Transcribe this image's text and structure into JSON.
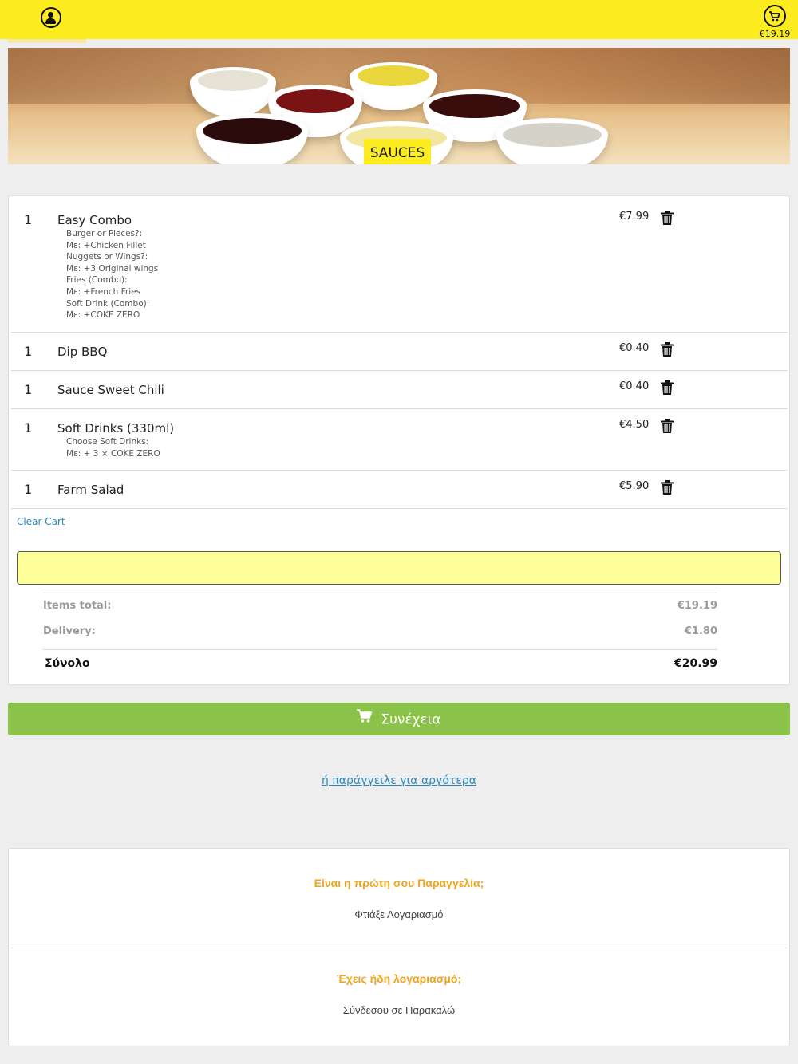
{
  "header": {
    "user_icon": "user-circle-icon",
    "cart_icon": "cart-circle-icon",
    "cart_total": "€19.19",
    "accent_color": "#fdec20"
  },
  "hero": {
    "label": "SAUCES"
  },
  "cart": {
    "items": [
      {
        "qty": "1",
        "name": "Easy Combo",
        "price": "€7.99",
        "options": [
          "Burger or Pieces?:",
          "Με: +Chicken Fillet",
          "Nuggets or Wings?:",
          "Με: +3 Original wings",
          "Fries (Combo):",
          "Με: +French Fries",
          "Soft Drink (Combo):",
          "Με: +COKE ZERO"
        ]
      },
      {
        "qty": "1",
        "name": "Dip BBQ",
        "price": "€0.40",
        "options": []
      },
      {
        "qty": "1",
        "name": "Sauce Sweet Chili",
        "price": "€0.40",
        "options": []
      },
      {
        "qty": "1",
        "name": "Soft Drinks (330ml)",
        "price": "€4.50",
        "options": [
          "Choose Soft Drinks:",
          "Με: + 3 × COKE ZERO"
        ]
      },
      {
        "qty": "1",
        "name": "Farm Salad",
        "price": "€5.90",
        "options": []
      }
    ],
    "clear_label": "Clear Cart",
    "coupon_value": "",
    "items_total_label": "Items total:",
    "items_total_value": "€19.19",
    "delivery_label": "Delivery:",
    "delivery_value": "€1.80",
    "grand_total_label": "Σύνολο",
    "grand_total_value": "€20.99"
  },
  "actions": {
    "continue_label": "Συνέχεια",
    "continue_color": "#8bc34a",
    "order_later_label": "ή παράγγειλε για αργότερα"
  },
  "account": {
    "new_title": "Είναι η πρώτη σου Παραγγελία;",
    "create_label": "Φτιάξε Λογαριασμό",
    "existing_title": "Έχεις ήδη λογαριασμό;",
    "login_label": "Σύνδεσου σε Παρακαλώ",
    "title_color": "#f0a51e"
  }
}
